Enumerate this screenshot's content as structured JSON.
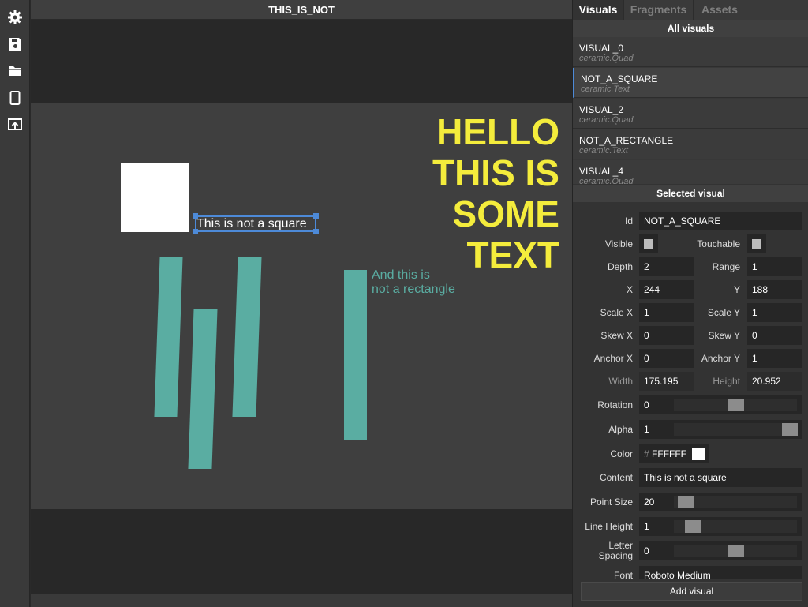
{
  "title": "THIS_IS_NOT",
  "toolbar": {
    "items": [
      {
        "icon": "gear-icon"
      },
      {
        "icon": "save-icon"
      },
      {
        "icon": "folder-icon"
      },
      {
        "icon": "device-icon"
      },
      {
        "icon": "export-icon"
      }
    ]
  },
  "canvas": {
    "text_square": "This is not a square",
    "text_rectangle_line1": "And this is",
    "text_rectangle_line2": "not a rectangle",
    "hello_lines": [
      "HELLO",
      "THIS IS",
      "SOME",
      "TEXT"
    ],
    "colors": {
      "accent_teal": "#5aada2",
      "hello_yellow": "#f4ec3c",
      "selection_blue": "#4d8ad8"
    }
  },
  "tabs": [
    {
      "label": "Visuals",
      "active": true
    },
    {
      "label": "Fragments",
      "active": false
    },
    {
      "label": "Assets",
      "active": false
    }
  ],
  "visuals_header": "All visuals",
  "visuals": [
    {
      "name": "VISUAL_0",
      "type": "ceramic.Quad"
    },
    {
      "name": "NOT_A_SQUARE",
      "type": "ceramic.Text"
    },
    {
      "name": "VISUAL_2",
      "type": "ceramic.Quad"
    },
    {
      "name": "NOT_A_RECTANGLE",
      "type": "ceramic.Text"
    },
    {
      "name": "VISUAL_4",
      "type": "ceramic.Quad"
    }
  ],
  "selected_header": "Selected visual",
  "props": {
    "id_label": "Id",
    "id": "NOT_A_SQUARE",
    "visible_label": "Visible",
    "touchable_label": "Touchable",
    "depth_label": "Depth",
    "depth": "2",
    "range_label": "Range",
    "range": "1",
    "x_label": "X",
    "x": "244",
    "y_label": "Y",
    "y": "188",
    "scalex_label": "Scale X",
    "scalex": "1",
    "scaley_label": "Scale Y",
    "scaley": "1",
    "skewx_label": "Skew X",
    "skewx": "0",
    "skewy_label": "Skew Y",
    "skewy": "0",
    "anchorx_label": "Anchor X",
    "anchorx": "0",
    "anchory_label": "Anchor Y",
    "anchory": "1",
    "width_label": "Width",
    "width": "175.195",
    "height_label": "Height",
    "height": "20.952",
    "rotation_label": "Rotation",
    "rotation": "0",
    "alpha_label": "Alpha",
    "alpha": "1",
    "color_label": "Color",
    "color_hash": "#",
    "color": "FFFFFF",
    "content_label": "Content",
    "content": "This is not a square",
    "pointsize_label": "Point Size",
    "pointsize": "20",
    "lineheight_label": "Line Height",
    "lineheight": "1",
    "letterspacing_label1": "Letter",
    "letterspacing_label2": "Spacing",
    "letterspacing": "0",
    "font_label": "Font",
    "font": "Roboto Medium"
  },
  "add_visual": "Add visual"
}
